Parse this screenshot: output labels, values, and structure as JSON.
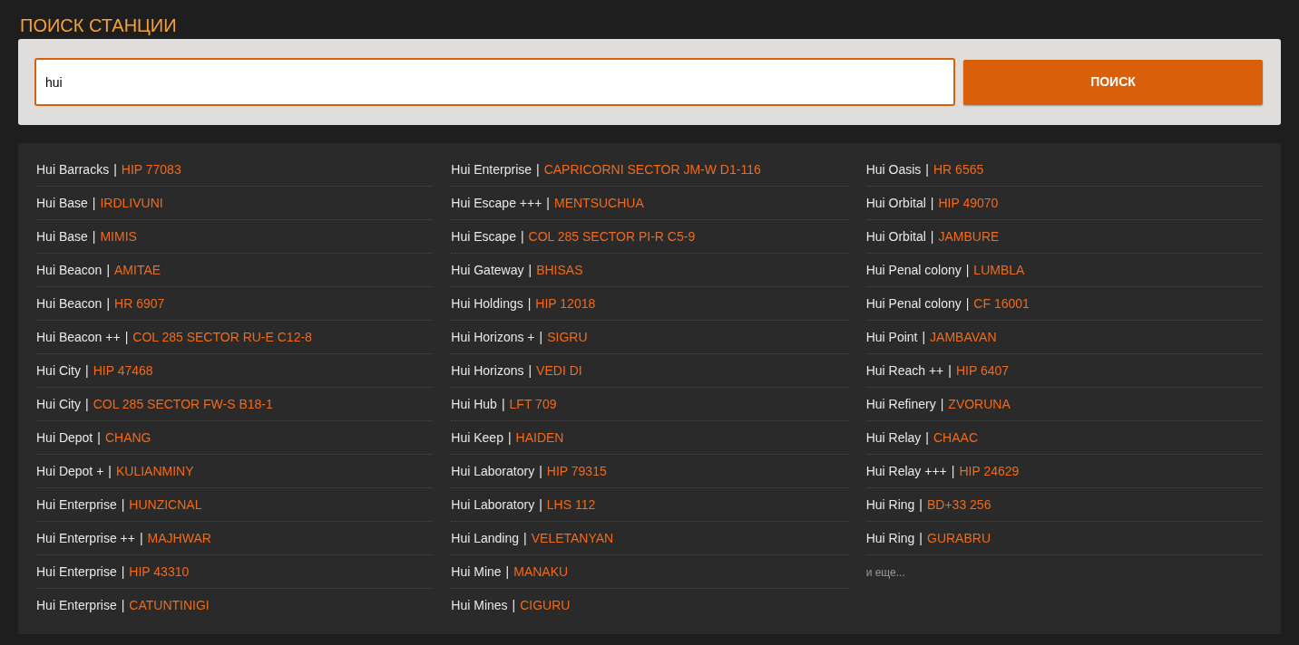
{
  "title": "ПОИСК СТАНЦИИ",
  "search": {
    "value": "hui",
    "button": "ПОИСК"
  },
  "columns": [
    {
      "items": [
        {
          "station": "Hui Barracks",
          "separator": "|",
          "system": "HIP 77083"
        },
        {
          "station": "Hui Base",
          "separator": "|",
          "system": "IRDLIVUNI"
        },
        {
          "station": "Hui Base",
          "separator": "|",
          "system": "MIMIS"
        },
        {
          "station": "Hui Beacon",
          "separator": "|",
          "system": "AMITAE"
        },
        {
          "station": "Hui Beacon",
          "separator": "|",
          "system": "HR 6907"
        },
        {
          "station": "Hui Beacon ++",
          "separator": "|",
          "system": "COL 285 SECTOR RU-E C12-8"
        },
        {
          "station": "Hui City",
          "separator": "|",
          "system": "HIP 47468"
        },
        {
          "station": "Hui City",
          "separator": "|",
          "system": "COL 285 SECTOR FW-S B18-1"
        },
        {
          "station": "Hui Depot",
          "separator": "|",
          "system": "CHANG"
        },
        {
          "station": "Hui Depot +",
          "separator": "|",
          "system": "KULIANMINY"
        },
        {
          "station": "Hui Enterprise",
          "separator": "|",
          "system": "HUNZICNAL"
        },
        {
          "station": "Hui Enterprise ++",
          "separator": "|",
          "system": "MAJHWAR"
        },
        {
          "station": "Hui Enterprise",
          "separator": "|",
          "system": "HIP 43310"
        },
        {
          "station": "Hui Enterprise",
          "separator": "|",
          "system": "CATUNTINIGI"
        }
      ]
    },
    {
      "items": [
        {
          "station": "Hui Enterprise",
          "separator": "|",
          "system": "CAPRICORNI SECTOR JM-W D1-116"
        },
        {
          "station": "Hui Escape +++",
          "separator": "|",
          "system": "MENTSUCHUA"
        },
        {
          "station": "Hui Escape",
          "separator": "|",
          "system": "COL 285 SECTOR PI-R C5-9"
        },
        {
          "station": "Hui Gateway",
          "separator": "|",
          "system": "BHISAS"
        },
        {
          "station": "Hui Holdings",
          "separator": "|",
          "system": "HIP 12018"
        },
        {
          "station": "Hui Horizons +",
          "separator": "|",
          "system": "SIGRU"
        },
        {
          "station": "Hui Horizons",
          "separator": "|",
          "system": "VEDI DI"
        },
        {
          "station": "Hui Hub",
          "separator": "|",
          "system": "LFT 709"
        },
        {
          "station": "Hui Keep",
          "separator": "|",
          "system": "HAIDEN"
        },
        {
          "station": "Hui Laboratory",
          "separator": "|",
          "system": "HIP 79315"
        },
        {
          "station": "Hui Laboratory",
          "separator": "|",
          "system": "LHS 112"
        },
        {
          "station": "Hui Landing",
          "separator": "|",
          "system": "VELETANYAN"
        },
        {
          "station": "Hui Mine",
          "separator": "|",
          "system": "MANAKU"
        },
        {
          "station": "Hui Mines",
          "separator": "|",
          "system": "CIGURU"
        }
      ]
    },
    {
      "items": [
        {
          "station": "Hui Oasis",
          "separator": "|",
          "system": "HR 6565"
        },
        {
          "station": "Hui Orbital",
          "separator": "|",
          "system": "HIP 49070"
        },
        {
          "station": "Hui Orbital",
          "separator": "|",
          "system": "JAMBURE"
        },
        {
          "station": "Hui Penal colony",
          "separator": "|",
          "system": "LUMBLA"
        },
        {
          "station": "Hui Penal colony",
          "separator": "|",
          "system": "CF 16001"
        },
        {
          "station": "Hui Point",
          "separator": "|",
          "system": "JAMBAVAN"
        },
        {
          "station": "Hui Reach ++",
          "separator": "|",
          "system": "HIP 6407"
        },
        {
          "station": "Hui Refinery",
          "separator": "|",
          "system": "ZVORUNA"
        },
        {
          "station": "Hui Relay",
          "separator": "|",
          "system": "CHAAC"
        },
        {
          "station": "Hui Relay +++",
          "separator": "|",
          "system": "HIP 24629"
        },
        {
          "station": "Hui Ring",
          "separator": "|",
          "system": "BD+33 256"
        },
        {
          "station": "Hui Ring",
          "separator": "|",
          "system": "GURABRU"
        }
      ],
      "more": "и еще..."
    }
  ]
}
